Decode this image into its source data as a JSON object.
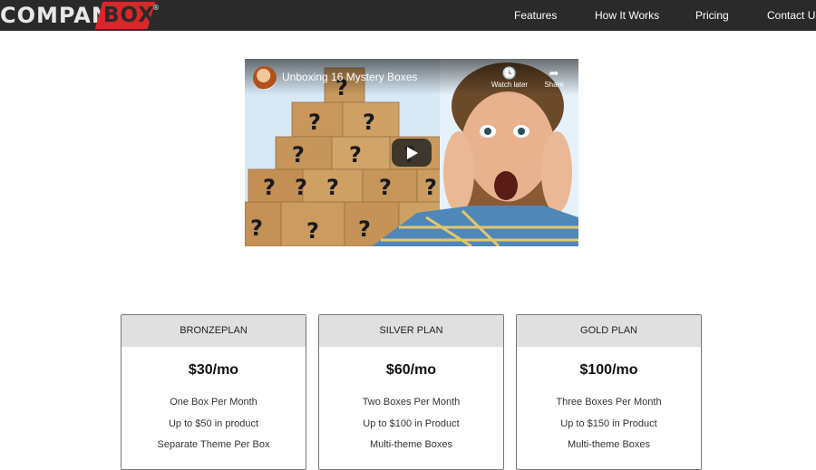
{
  "brand": {
    "part1": "COMPANY",
    "part2": "BOX",
    "mark": "®"
  },
  "nav": {
    "features": "Features",
    "how_it_works": "How It Works",
    "pricing": "Pricing",
    "contact": "Contact Us"
  },
  "video": {
    "title": "Unboxing 16 Mystery Boxes",
    "watch_later": "Watch later",
    "share": "Share",
    "icons": {
      "watch_later": "clock-icon",
      "share": "share-arrow-icon",
      "play": "play-icon"
    }
  },
  "plans": [
    {
      "name": "BRONZEPLAN",
      "price": "$30/mo",
      "features": [
        "One Box Per Month",
        "Up to $50 in product",
        "Separate Theme Per Box"
      ]
    },
    {
      "name": "SILVER PLAN",
      "price": "$60/mo",
      "features": [
        "Two Boxes Per Month",
        "Up to $100 in Product",
        "Multi-theme Boxes"
      ]
    },
    {
      "name": "GOLD PLAN",
      "price": "$100/mo",
      "features": [
        "Three Boxes Per Month",
        "Up to $150 in Product",
        "Multi-theme Boxes"
      ]
    }
  ],
  "colors": {
    "header_bg": "#2a2a2a",
    "brand_red": "#d9262b",
    "card_head_bg": "#e0e0e0"
  }
}
